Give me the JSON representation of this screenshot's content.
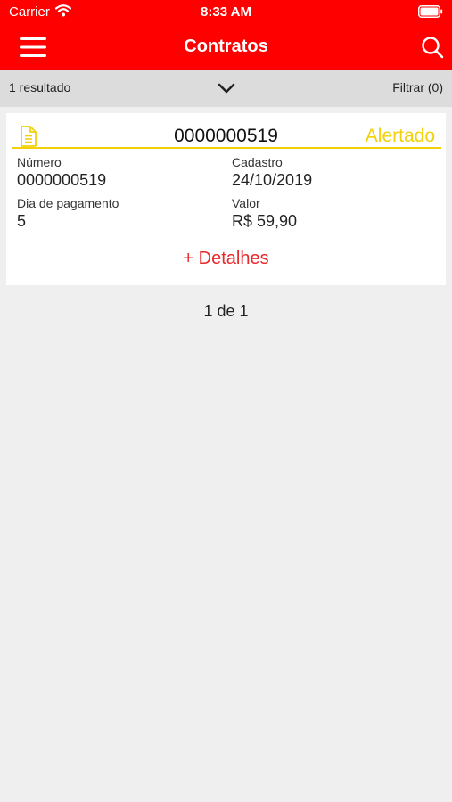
{
  "status_bar": {
    "carrier": "Carrier",
    "time": "8:33 AM"
  },
  "nav": {
    "title": "Contratos",
    "menu_icon": "hamburger-menu-icon",
    "search_icon": "search-icon"
  },
  "filter_bar": {
    "result_count": "1 resultado",
    "filter_label": "Filtrar (0)"
  },
  "contract": {
    "number_header": "0000000519",
    "status": "Alertado",
    "status_color": "#f2d10b",
    "fields": {
      "numero_label": "Número",
      "numero_value": "0000000519",
      "cadastro_label": "Cadastro",
      "cadastro_value": "24/10/2019",
      "pagamento_label": "Dia de pagamento",
      "pagamento_value": "5",
      "valor_label": "Valor",
      "valor_value": "R$ 59,90"
    },
    "details_link": "+ Detalhes"
  },
  "pagination": "1 de 1",
  "colors": {
    "brand": "#fe0000",
    "accent_link": "#e8282b",
    "background": "#efefef"
  }
}
